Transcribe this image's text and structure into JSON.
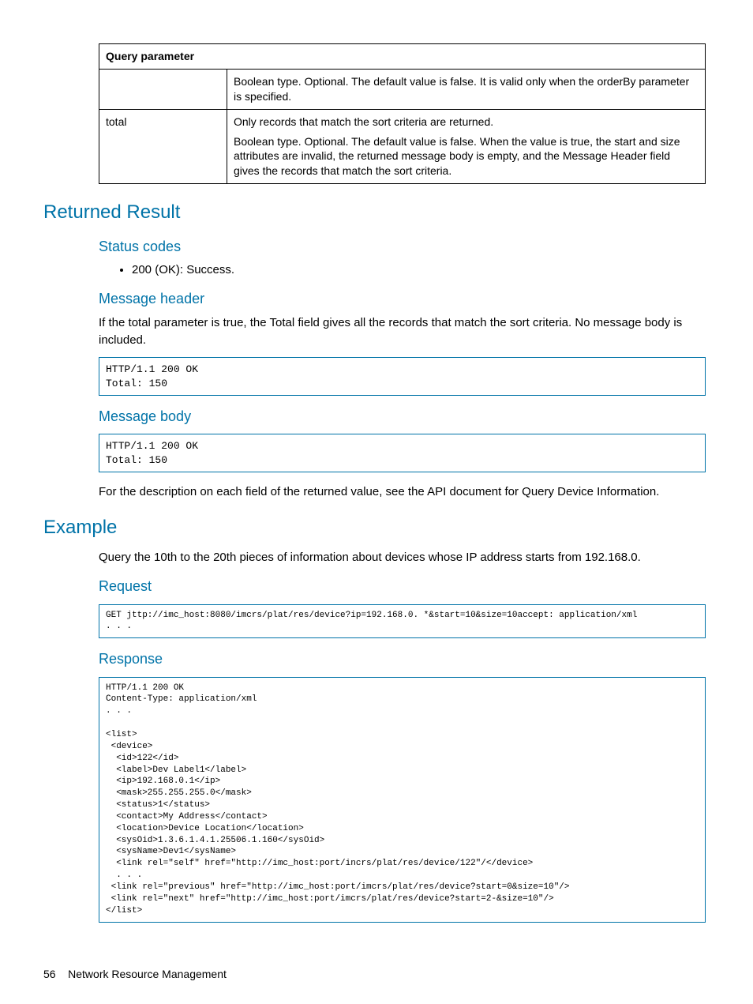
{
  "table": {
    "header": "Query parameter",
    "rows": [
      {
        "param": "",
        "desc": [
          "Boolean type. Optional. The default value is false. It is valid only when the orderBy parameter is specified."
        ]
      },
      {
        "param": "total",
        "desc": [
          "Only records that match the sort criteria are returned.",
          "Boolean type. Optional. The default value is false. When the value is true, the start and size attributes are invalid, the returned message body is empty, and the Message Header field gives the records that match the sort criteria."
        ]
      }
    ]
  },
  "returned": {
    "heading": "Returned Result",
    "status": {
      "heading": "Status codes",
      "item": "200 (OK): Success."
    },
    "msgHeader": {
      "heading": "Message header",
      "text": "If the total parameter is true, the Total field gives all the records that match the sort criteria. No message body is included.",
      "code": "HTTP/1.1 200 OK\nTotal: 150"
    },
    "msgBody": {
      "heading": "Message body",
      "code": "HTTP/1.1 200 OK\nTotal: 150",
      "after": "For the description on each field of the returned value, see the API document for Query Device Information."
    }
  },
  "example": {
    "heading": "Example",
    "intro": "Query the 10th to the 20th pieces of information about devices whose IP address starts from 192.168.0.",
    "request": {
      "heading": "Request",
      "code": "GET jttp://imc_host:8080/imcrs/plat/res/device?ip=192.168.0. *&start=10&size=10accept: application/xml\n. . ."
    },
    "response": {
      "heading": "Response",
      "code": "HTTP/1.1 200 OK\nContent-Type: application/xml\n. . .\n\n<list>\n <device>\n  <id>122</id>\n  <label>Dev Label1</label>\n  <ip>192.168.0.1</ip>\n  <mask>255.255.255.0</mask>\n  <status>1</status>\n  <contact>My Address</contact>\n  <location>Device Location</location>\n  <sysOid>1.3.6.1.4.1.25506.1.160</sysOid>\n  <sysName>Dev1</sysName>\n  <link rel=\"self\" href=\"http://imc_host:port/incrs/plat/res/device/122\"/</device>\n  . . .\n <link rel=\"previous\" href=\"http://imc_host:port/imcrs/plat/res/device?start=0&size=10\"/>\n <link rel=\"next\" href=\"http://imc_host:port/imcrs/plat/res/device?start=2-&size=10\"/>\n</list>"
    }
  },
  "footer": {
    "page": "56",
    "title": "Network Resource Management"
  }
}
